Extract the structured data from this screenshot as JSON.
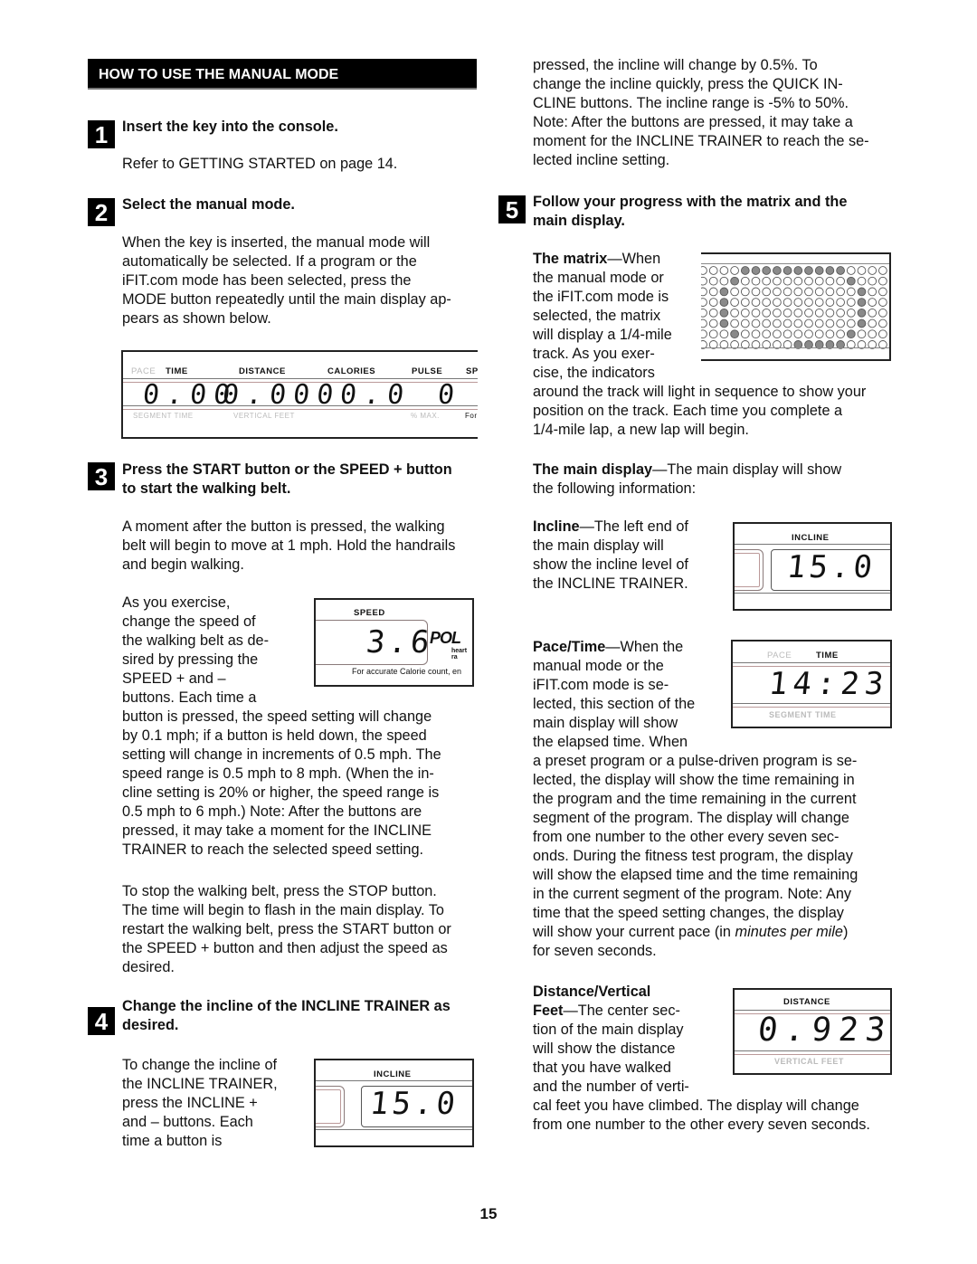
{
  "section_header": "HOW TO USE THE MANUAL MODE",
  "steps": [
    {
      "number": "1",
      "title": "Insert the key into the console.",
      "body": "Refer to GETTING STARTED on page 14."
    },
    {
      "number": "2",
      "title": "Select the manual mode.",
      "body": [
        "When the key is inserted, the manual mode will",
        "automatically be selected. If a program or the",
        "iFIT.com mode has been selected, press the",
        "MODE button repeatedly until the main display ap-",
        "pears as shown below."
      ]
    },
    {
      "number": "3",
      "title": [
        "Press the START button or the SPEED + button",
        "to start the walking belt."
      ],
      "body1": [
        "A moment after the button is pressed, the walking",
        "belt will begin to move at 1 mph. Hold the handrails",
        "and begin walking."
      ],
      "body2_wrap": [
        "As you exercise,",
        "change the speed of",
        "the walking belt as de-",
        "sired by pressing the",
        "SPEED + and –",
        "buttons. Each time a"
      ],
      "body2_full": [
        "button is pressed, the speed setting will change",
        "by 0.1 mph; if a button is held down, the speed",
        "setting will change in increments of 0.5 mph. The",
        "speed range is 0.5 mph to 8 mph. (When the in-",
        "cline setting is 20% or higher, the speed range is",
        "0.5 mph to 6 mph.) Note: After the buttons are",
        "pressed, it may take a moment for the INCLINE",
        "TRAINER to reach the selected speed setting."
      ],
      "body3": [
        "To stop the walking belt, press the STOP button.",
        "The time will begin to flash in the main display. To",
        "restart the walking belt, press the START button or",
        "the SPEED + button and then adjust the speed as",
        "desired."
      ]
    },
    {
      "number": "4",
      "title": [
        "Change the incline of the INCLINE TRAINER as",
        "desired."
      ],
      "body_wrap": [
        "To change the incline of",
        "the INCLINE TRAINER,",
        "press the INCLINE +",
        "and – buttons. Each",
        "time a button is"
      ]
    },
    {
      "number": "5",
      "title": [
        "Follow your progress with the matrix and the",
        "main display."
      ]
    }
  ],
  "right_top": [
    "pressed, the incline will change by 0.5%. To",
    "change the incline quickly, press the QUICK IN-",
    "CLINE buttons. The incline range is -5% to 50%.",
    "Note: After the buttons are pressed, it may take a",
    "moment for the INCLINE TRAINER to reach the se-",
    "lected incline setting."
  ],
  "matrix": {
    "term": "The matrix",
    "wrap": [
      "—When",
      "the manual mode or",
      "the iFIT.com mode is",
      "selected, the matrix",
      "will display a 1/4-mile",
      "track. As you exer-",
      "cise, the indicators"
    ],
    "full": [
      "around the track will light in sequence to show your",
      "position on the track. Each time you complete a",
      "1/4-mile lap, a new lap will begin."
    ],
    "rows": [
      "000011111111110000",
      "000100000000001000",
      "001000000000000100",
      "001000000000000100",
      "001000000000000100",
      "001000000000000100",
      "000100000000001000",
      "000000000111110000"
    ]
  },
  "main_display": {
    "term": "The main display",
    "rest": "—The main display will show",
    "line2": "the following information:"
  },
  "incline": {
    "term": "Incline",
    "wrap": [
      "—The left end of",
      "the main display will",
      "show the incline level of",
      "the INCLINE TRAINER."
    ]
  },
  "pace_time": {
    "term": "Pace/Time",
    "wrap": [
      "—When the",
      "manual mode or the",
      "iFIT.com mode is se-",
      "lected, this section of the",
      "main display will show",
      "the elapsed time. When"
    ],
    "full_before_em": [
      "a preset program or a pulse-driven program is se-",
      "lected, the display will show the time remaining in",
      "the program and the time remaining in the current",
      "segment of the program. The display will change",
      "from one number to the other every seven sec-",
      "onds. During the fitness test program, the display",
      "will show the elapsed time and the time remaining",
      "in the current segment of the program. Note: Any",
      "time that the speed setting changes, the display"
    ],
    "em_line_pre": "will show your current pace (in ",
    "em_text": "minutes per mile",
    "em_line_post": ")",
    "last": "for seven seconds."
  },
  "distance": {
    "term1": "Distance/Vertical",
    "term2": "Feet",
    "wrap": [
      "—The center sec-",
      "tion of the main display",
      "will show the distance",
      "that you have walked",
      "and the number of verti-"
    ],
    "full": [
      "cal feet you have climbed. The display will change",
      "from one number to the other every seven seconds."
    ]
  },
  "displays": {
    "main": {
      "labels_top": [
        "PACE",
        "TIME",
        "DISTANCE",
        "CALORIES",
        "PULSE",
        "SP"
      ],
      "labels_bottom": [
        "SEGMENT TIME",
        "VERTICAL FEET",
        "% MAX.",
        "For"
      ],
      "values": [
        "0.00",
        "0.000",
        "0.0",
        "0"
      ]
    },
    "speed": {
      "label": "SPEED",
      "value": "3.6",
      "brand": "POL",
      "brand_sub": "heart ra",
      "note": "For accurate Calorie count, en"
    },
    "incline_small": {
      "label": "INCLINE",
      "value": "15.0"
    },
    "incline_right": {
      "label": "INCLINE",
      "value": "15.0"
    },
    "pace_time": {
      "label_dim": "PACE",
      "label": "TIME",
      "value": "14:23",
      "label_bottom": "SEGMENT TIME"
    },
    "distance": {
      "label": "DISTANCE",
      "value": "0.923",
      "label_bottom": "VERTICAL FEET"
    }
  },
  "page_number": "15"
}
